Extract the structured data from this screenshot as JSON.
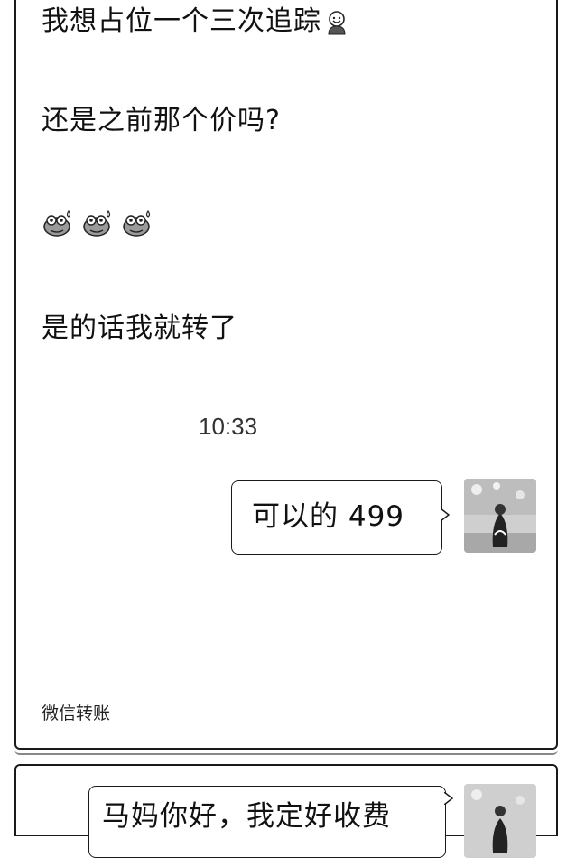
{
  "messages": {
    "line1": "我想占位一个三次追踪",
    "line1_emoji": "smiling-face-emoji",
    "line2": "还是之前那个价吗?",
    "emoji_row": [
      "sweat-face-emoji",
      "sweat-face-emoji",
      "sweat-face-emoji"
    ],
    "line4": "是的话我就转了"
  },
  "timestamp": "10:33",
  "reply": {
    "text": "可以的 499",
    "avatar_icon": "user-avatar"
  },
  "footer_label": "微信转账",
  "next_panel": {
    "text": "马妈你好，我定好收费",
    "avatar_icon": "user-avatar"
  },
  "colors": {
    "text": "#111111",
    "border": "#1a1a1a",
    "background": "#ffffff"
  }
}
